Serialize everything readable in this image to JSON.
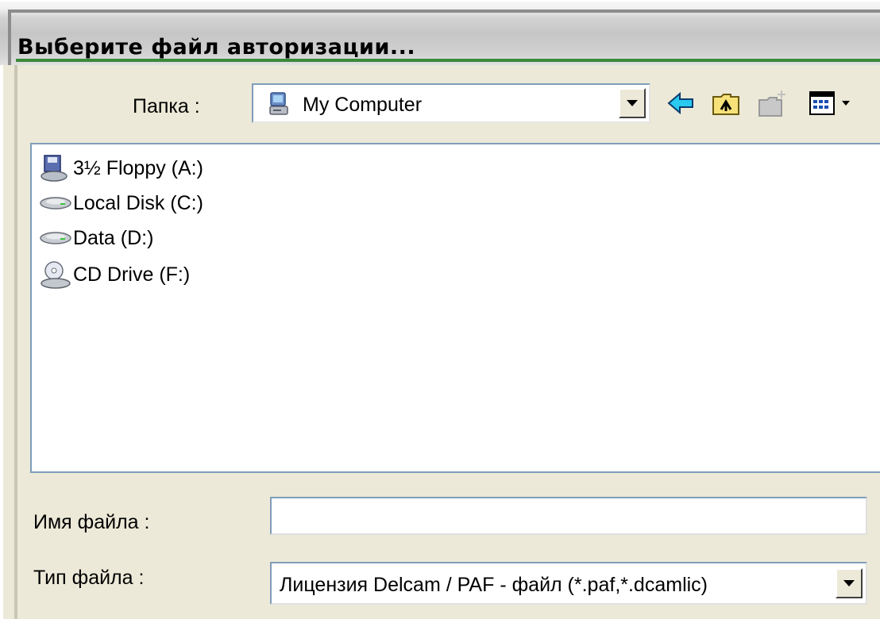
{
  "window": {
    "title": "Выберите файл авторизации..."
  },
  "toolbar": {
    "folder_label": "Папка :",
    "folder_value": "My Computer",
    "folder_icon": "computer-icon",
    "buttons": [
      "back-icon",
      "up-folder-icon",
      "new-folder-icon",
      "view-menu-icon"
    ]
  },
  "file_list": {
    "items": [
      {
        "name": "3½ Floppy (A:)",
        "icon": "floppy-drive-icon"
      },
      {
        "name": "Local Disk (C:)",
        "icon": "hard-disk-icon"
      },
      {
        "name": "Data (D:)",
        "icon": "hard-disk-icon"
      },
      {
        "name": "CD Drive (F:)",
        "icon": "cd-drive-icon"
      }
    ]
  },
  "filename": {
    "label": "Имя файла :",
    "value": ""
  },
  "filetype": {
    "label": "Тип файла :",
    "value": "Лицензия Delcam / PAF - файл (*.paf,*.dcamlic)"
  },
  "colors": {
    "dialog_bg": "#ece9d8",
    "field_border": "#7f9db9",
    "title_accent": "#3a8a3a"
  }
}
